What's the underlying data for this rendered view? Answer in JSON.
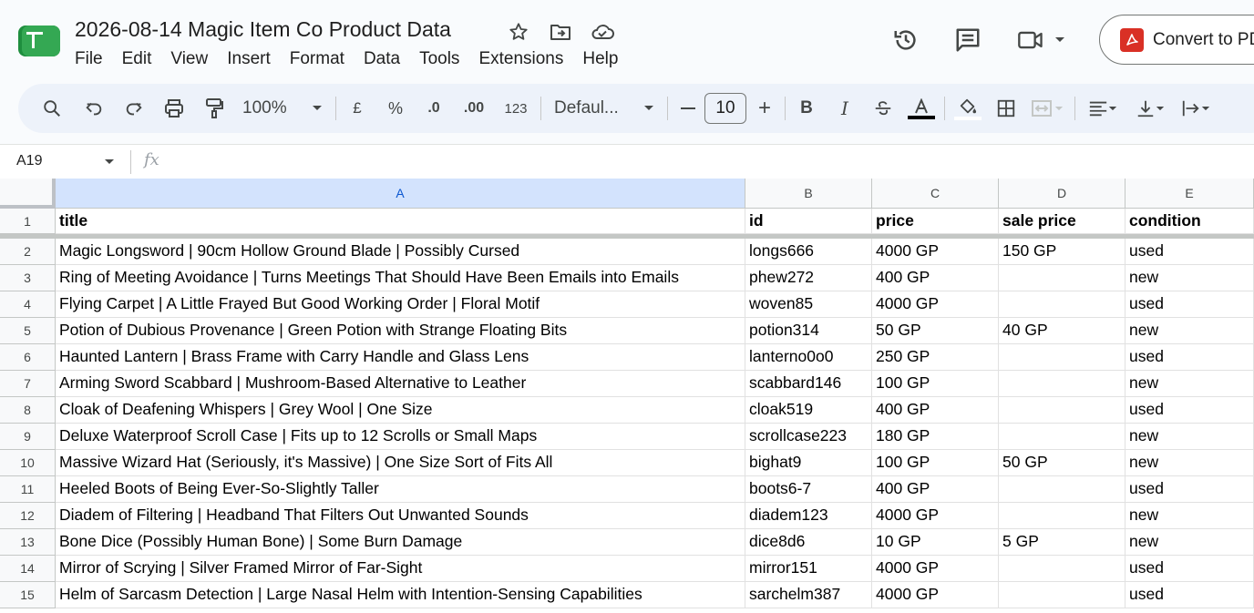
{
  "doc": {
    "title": "2026-08-14 Magic Item Co Product Data"
  },
  "menu": [
    "File",
    "Edit",
    "View",
    "Insert",
    "Format",
    "Data",
    "Tools",
    "Extensions",
    "Help"
  ],
  "actions": {
    "convert_label": "Convert to PDF"
  },
  "toolbar": {
    "zoom": "100%",
    "currency": "£",
    "percent": "%",
    "decrease_decimal": ".0",
    "increase_decimal": ".00",
    "number_format": "123",
    "font": "Defaul...",
    "font_size": "10",
    "minus": "—",
    "plus": "+",
    "bold": "B",
    "italic": "I"
  },
  "formula_bar": {
    "name_box": "A19",
    "fx": "fx"
  },
  "sheet": {
    "selected_column": "A",
    "columns": [
      "A",
      "B",
      "C",
      "D",
      "E"
    ],
    "header_row": [
      "title",
      "id",
      "price",
      "sale price",
      "condition"
    ],
    "rows": [
      [
        "Magic Longsword | 90cm Hollow Ground Blade | Possibly Cursed",
        "longs666",
        "4000 GP",
        "150 GP",
        "used"
      ],
      [
        "Ring of Meeting Avoidance | Turns Meetings That Should Have Been Emails into Emails",
        "phew272",
        "400 GP",
        "",
        "new"
      ],
      [
        "Flying Carpet | A Little Frayed But Good Working Order | Floral Motif",
        "woven85",
        "4000 GP",
        "",
        "used"
      ],
      [
        "Potion of Dubious Provenance | Green Potion with Strange Floating Bits",
        "potion314",
        "50 GP",
        "40 GP",
        "new"
      ],
      [
        "Haunted Lantern | Brass Frame with Carry Handle and Glass Lens",
        "lanterno0o0",
        "250 GP",
        "",
        "used"
      ],
      [
        "Arming Sword Scabbard | Mushroom-Based Alternative to Leather",
        "scabbard146",
        "100 GP",
        "",
        "new"
      ],
      [
        "Cloak of Deafening Whispers | Grey Wool | One Size",
        "cloak519",
        "400 GP",
        "",
        "used"
      ],
      [
        "Deluxe Waterproof Scroll Case | Fits up to 12 Scrolls or Small Maps",
        "scrollcase223",
        "180 GP",
        "",
        "new"
      ],
      [
        "Massive Wizard Hat (Seriously, it's Massive) | One Size Sort of Fits All",
        "bighat9",
        "100 GP",
        "50 GP",
        "new"
      ],
      [
        "Heeled Boots of Being Ever-So-Slightly Taller",
        "boots6-7",
        "400 GP",
        "",
        "used"
      ],
      [
        "Diadem of Filtering | Headband That Filters Out Unwanted Sounds",
        "diadem123",
        "4000 GP",
        "",
        "new"
      ],
      [
        "Bone Dice (Possibly Human Bone) | Some Burn Damage",
        "dice8d6",
        "10 GP",
        "5 GP",
        "new"
      ],
      [
        "Mirror of Scrying | Silver Framed Mirror of Far-Sight",
        "mirror151",
        "4000 GP",
        "",
        "used"
      ],
      [
        "Helm of Sarcasm Detection | Large Nasal Helm with Intention-Sensing Capabilities",
        "sarchelm387",
        "4000 GP",
        "",
        "used"
      ]
    ],
    "row_numbers": [
      "1",
      "2",
      "3",
      "4",
      "5",
      "6",
      "7",
      "8",
      "9",
      "10",
      "11",
      "12",
      "13",
      "14",
      "15"
    ]
  }
}
